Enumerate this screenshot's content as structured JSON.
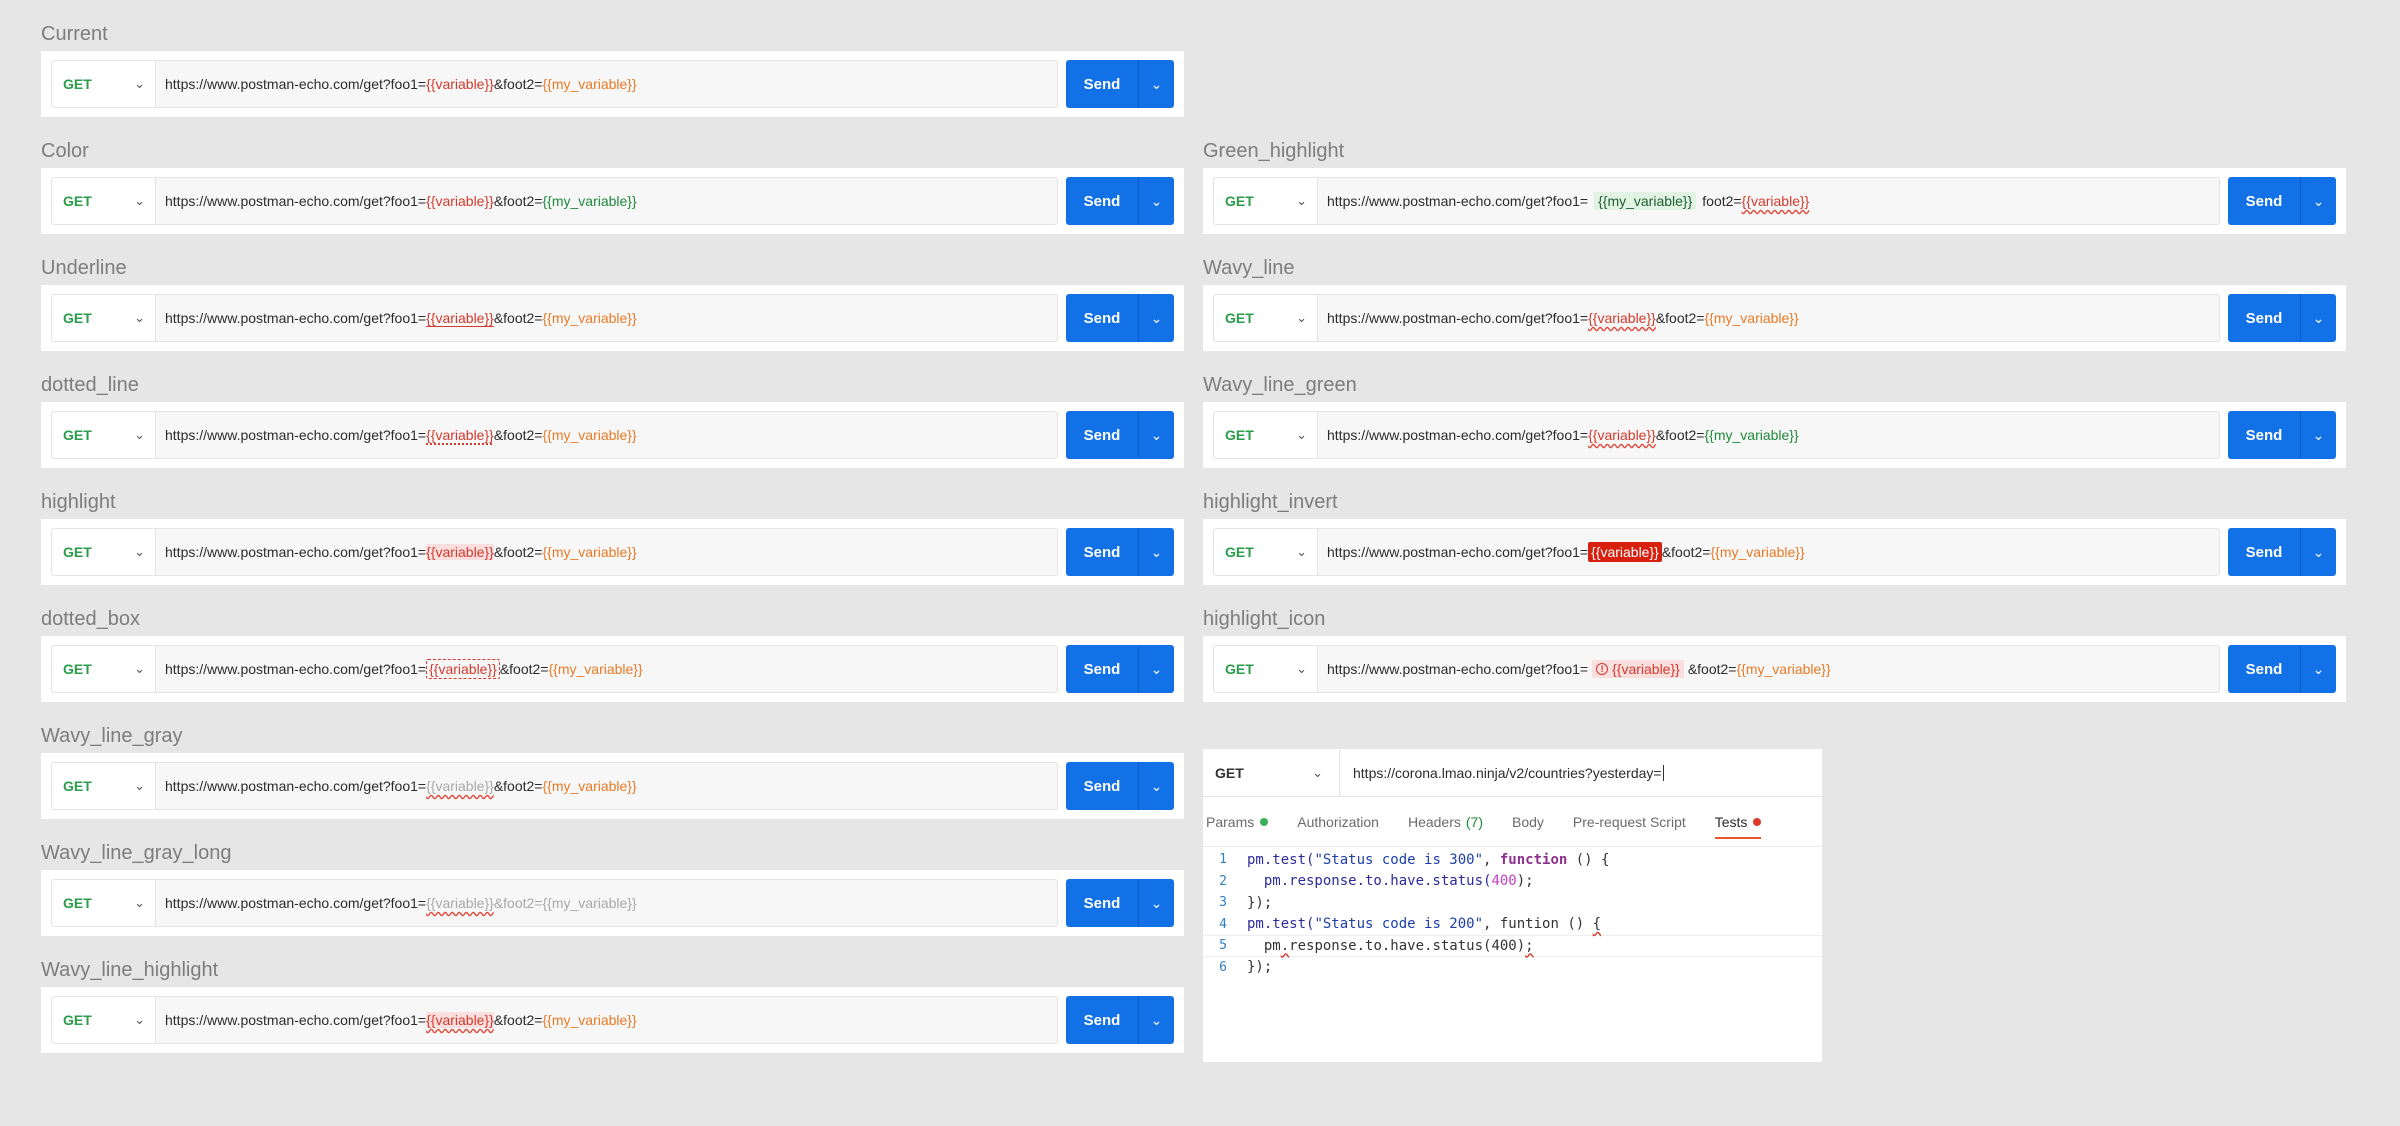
{
  "send_label": "Send",
  "blocks": [
    {
      "title": "Current",
      "method": "GET",
      "url_prefix": "https://www.postman-echo.com/get?foo1=",
      "var1": "{{variable}}",
      "mid": "&foot2=",
      "var2": "{{my_variable}}"
    },
    {
      "title": "Color",
      "method": "GET",
      "url_prefix": "https://www.postman-echo.com/get?foo1=",
      "var1": "{{variable}}",
      "mid": "&foot2=",
      "var2": "{{my_variable}}"
    },
    {
      "title": "Underline",
      "method": "GET",
      "url_prefix": "https://www.postman-echo.com/get?foo1=",
      "var1": "{{variable}}",
      "mid": "&foot2=",
      "var2": "{{my_variable}}"
    },
    {
      "title": "dotted_line",
      "method": "GET",
      "url_prefix": "https://www.postman-echo.com/get?foo1=",
      "var1": "{{variable}}",
      "mid": "&foot2=",
      "var2": "{{my_variable}}"
    },
    {
      "title": "highlight",
      "method": "GET",
      "url_prefix": "https://www.postman-echo.com/get?foo1=",
      "var1": "{{variable}}",
      "mid": "&foot2=",
      "var2": "{{my_variable}}"
    },
    {
      "title": "dotted_box",
      "method": "GET",
      "url_prefix": "https://www.postman-echo.com/get?foo1=",
      "var1": "{{variable}}",
      "mid": "&foot2=",
      "var2": "{{my_variable}}"
    },
    {
      "title": "Wavy_line_gray",
      "method": "GET",
      "url_prefix": "https://www.postman-echo.com/get?foo1=",
      "var1": "{{variable}}",
      "mid": "&foot2=",
      "var2": "{{my_variable}}"
    },
    {
      "title": "Wavy_line_gray_long",
      "method": "GET",
      "url_prefix": "https://www.postman-echo.com/get?foo1=",
      "var1": "{{variable}}",
      "mid": "&foot2=",
      "var2": "{{my_variable}}"
    },
    {
      "title": "Wavy_line_highlight",
      "method": "GET",
      "url_prefix": "https://www.postman-echo.com/get?foo1=",
      "var1": "{{variable}}",
      "mid": "&foot2=",
      "var2": "{{my_variable}}"
    },
    {
      "title": "Green_highlight",
      "method": "GET",
      "url_prefix": "https://www.postman-echo.com/get?foo1=",
      "var1": "{{my_variable}}",
      "mid": "foot2=",
      "var2": "{{variable}}"
    },
    {
      "title": "Wavy_line",
      "method": "GET",
      "url_prefix": "https://www.postman-echo.com/get?foo1=",
      "var1": "{{variable}}",
      "mid": "&foot2=",
      "var2": "{{my_variable}}"
    },
    {
      "title": "Wavy_line_green",
      "method": "GET",
      "url_prefix": "https://www.postman-echo.com/get?foo1=",
      "var1": "{{variable}}",
      "mid": "&foot2=",
      "var2": "{{my_variable}}"
    },
    {
      "title": "highlight_invert",
      "method": "GET",
      "url_prefix": "https://www.postman-echo.com/get?foo1=",
      "var1": "{{variable}}",
      "mid": "&foot2=",
      "var2": "{{my_variable}}"
    },
    {
      "title": "highlight_icon",
      "method": "GET",
      "url_prefix": "https://www.postman-echo.com/get?foo1=",
      "var1": "{{variable}}",
      "mid": "&foot2=",
      "var2": "{{my_variable}}"
    }
  ],
  "editor": {
    "method": "GET",
    "url": "https://corona.lmao.ninja/v2/countries?yesterday=",
    "tabs": {
      "params": "Params",
      "authorization": "Authorization",
      "headers": "Headers",
      "headers_count": "(7)",
      "body": "Body",
      "prerequest": "Pre-request Script",
      "tests": "Tests"
    },
    "colors": {
      "params_dot": "#3fae5a",
      "tests_dot": "#e0392b",
      "accent": "#e8572f"
    },
    "line_numbers": [
      "1",
      "2",
      "3",
      "4",
      "5",
      "6"
    ],
    "code": {
      "l1_obj": "pm",
      "l1_fn": ".test(",
      "l1_str": "\"Status code is 300\"",
      "l1_sep": ", ",
      "l1_kw": "function",
      "l1_end": " () {",
      "l2_pre": "  pm",
      "l2_mid": ".response.to.have.status(",
      "l2_num": "400",
      "l2_end": ");",
      "l3": "});",
      "l4_obj": "pm",
      "l4_fn": ".test(",
      "l4_str": "\"Status code is 200\"",
      "l4_sep": ", ",
      "l4_word": "funtion",
      "l4_paren": " () ",
      "l4_brace": "{",
      "l5_pre": "  pm",
      "l5_dot": ".",
      "l5_mid": "response.to.have.status(400)",
      "l5_semi": ";",
      "l6": "});"
    }
  }
}
